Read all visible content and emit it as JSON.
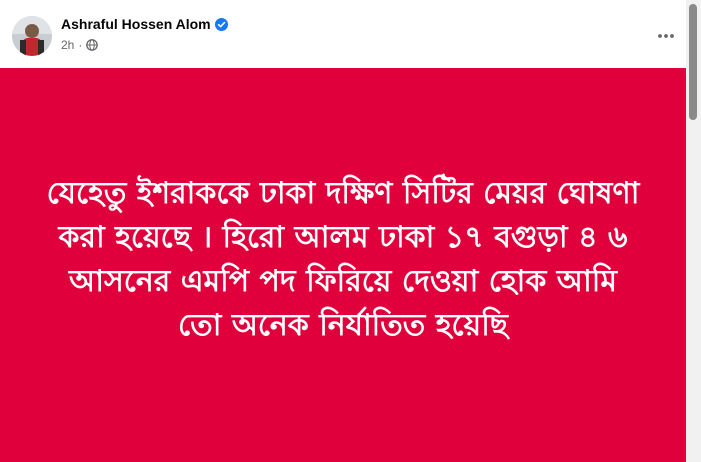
{
  "post": {
    "author": "Ashraful Hossen Alom",
    "time": "2h",
    "separator": "·",
    "privacy_icon": "globe-icon",
    "verified_icon": "verified-badge-icon",
    "more_label": "···",
    "text": "যেহেতু ইশরাককে ঢাকা দক্ষিণ সিটির মেয়র ঘোষণা করা হয়েছে । হিরো আলম ঢাকা ১৭ বগুড়া ৪ ৬ আসনের এমপি পদ ফিরিয়ে দেওয়া হোক আমি তো অনেক নির্যাতিত হয়েছি"
  },
  "colors": {
    "media_background": "#e0003c",
    "verified_blue": "#1877f2",
    "secondary_text": "#65676b"
  }
}
